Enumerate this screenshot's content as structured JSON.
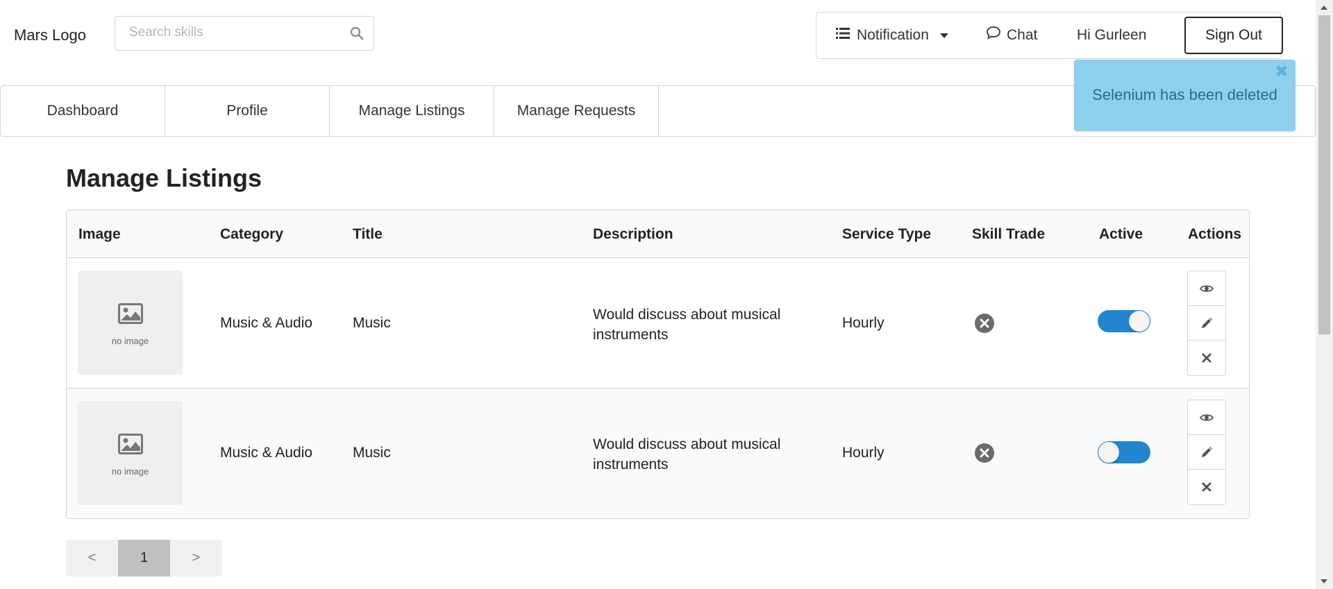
{
  "header": {
    "logo": "Mars Logo",
    "search_placeholder": "Search skills",
    "notification_label": "Notification",
    "chat_label": "Chat",
    "greeting": "Hi Gurleen",
    "signout_label": "Sign Out"
  },
  "tabs": [
    {
      "label": "Dashboard"
    },
    {
      "label": "Profile"
    },
    {
      "label": "Manage Listings"
    },
    {
      "label": "Manage Requests"
    }
  ],
  "toast": {
    "message": "Selenium has been deleted",
    "close_symbol": "✖"
  },
  "page_title": "Manage Listings",
  "table": {
    "columns": [
      "Image",
      "Category",
      "Title",
      "Description",
      "Service Type",
      "Skill Trade",
      "Active",
      "Actions"
    ],
    "rows": [
      {
        "image_label": "no image",
        "category": "Music & Audio",
        "title": "Music",
        "description": "Would discuss about musical instruments",
        "service_type": "Hourly",
        "skill_trade": "false",
        "active": "on"
      },
      {
        "image_label": "no image",
        "category": "Music & Audio",
        "title": "Music",
        "description": "Would discuss about musical instruments",
        "service_type": "Hourly",
        "skill_trade": "false",
        "active": "off"
      }
    ]
  },
  "pagination": {
    "prev": "<",
    "current": "1",
    "next": ">"
  },
  "icons": {
    "search": "search-icon",
    "notification": "list-icon",
    "chat": "chat-bubble-icon",
    "image_placeholder": "image-icon",
    "skill_trade": "x-circle-icon",
    "view": "eye-icon",
    "edit": "pencil-icon",
    "delete": "close-icon"
  },
  "colors": {
    "toggle_on": "#2185d0",
    "toast_bg": "#8fcfee",
    "toast_text": "#2a6a8f"
  }
}
